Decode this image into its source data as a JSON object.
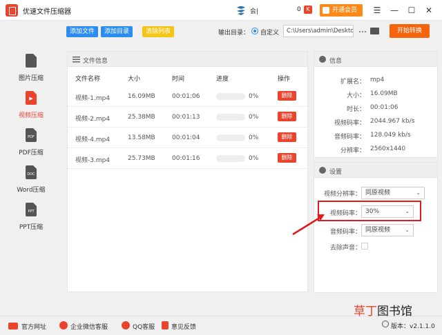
{
  "app": {
    "title": "优速文件压缩器"
  },
  "titlebar": {
    "user": "会|",
    "count": "0",
    "badge": "K",
    "vip_label": "开通会员",
    "menu": "☰",
    "minimize": "—",
    "maximize": "☐",
    "close": "✕"
  },
  "sidebar": {
    "items": [
      {
        "label": "图片压缩",
        "icon": ""
      },
      {
        "label": "视频压缩",
        "icon": "▶"
      },
      {
        "label": "PDF压缩",
        "icon": "PDF"
      },
      {
        "label": "Word压缩",
        "icon": "DOC"
      },
      {
        "label": "PPT压缩",
        "icon": "PPT"
      }
    ],
    "active": 1
  },
  "toolbar": {
    "add_file": "添加文件",
    "add_dir": "添加目录",
    "clear": "清除列表",
    "output_label": "输出目录：",
    "radio_label": "自定义",
    "path": "C:\\Users\\admin\\Deskto",
    "start": "开始转换"
  },
  "files": {
    "title": "文件信息",
    "columns": [
      "文件名称",
      "大小",
      "时间",
      "进度",
      "操作"
    ],
    "rows": [
      {
        "name": "视频-1.mp4",
        "size": "16.09MB",
        "time": "00:01:06",
        "progress": "0%",
        "action": "删除"
      },
      {
        "name": "视频-2.mp4",
        "size": "25.38MB",
        "time": "00:01:13",
        "progress": "0%",
        "action": "删除"
      },
      {
        "name": "视频-4.mp4",
        "size": "13.58MB",
        "time": "00:01:04",
        "progress": "0%",
        "action": "删除"
      },
      {
        "name": "视频-3.mp4",
        "size": "25.73MB",
        "time": "00:01:16",
        "progress": "0%",
        "action": "删除"
      }
    ]
  },
  "info": {
    "title": "信息",
    "fields": [
      {
        "key": "扩展名：",
        "value": "mp4"
      },
      {
        "key": "大小：",
        "value": "16.09MB"
      },
      {
        "key": "时长：",
        "value": "00:01:06"
      },
      {
        "key": "视频码率：",
        "value": "2044.967 kb/s"
      },
      {
        "key": "音频码率：",
        "value": "128.049 kb/s"
      },
      {
        "key": "分辨率：",
        "value": "2560x1440"
      }
    ]
  },
  "settings": {
    "title": "设置",
    "video_resolution": {
      "label": "视频分辨率：",
      "value": "同原视频"
    },
    "video_bitrate": {
      "label": "视频码率：",
      "value": "30%"
    },
    "audio_bitrate": {
      "label": "音频码率：",
      "value": "同原视频"
    },
    "remove_audio": {
      "label": "去除声音："
    }
  },
  "footer": {
    "site": "官方网址",
    "wechat": "企业微信客服",
    "qq": "QQ客服",
    "feedback": "意见反馈",
    "version": "版本：v2.1.1.0"
  },
  "watermark": {
    "part1": "草丁",
    "part2": "图书馆"
  },
  "colors": {
    "accent": "#e8442e",
    "blue": "#2d8cf0",
    "yellow": "#f5c518",
    "orange": "#f5640c"
  }
}
